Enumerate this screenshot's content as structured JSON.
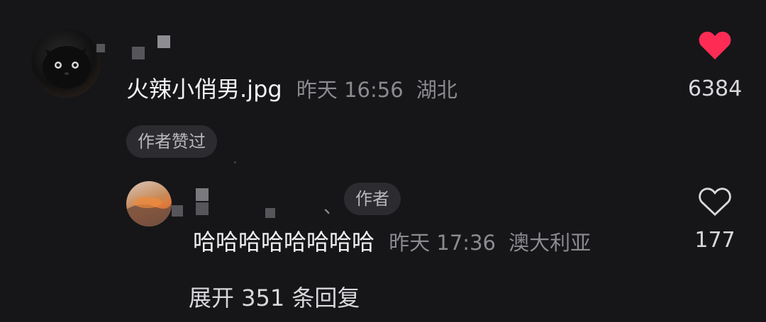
{
  "comment": {
    "text": "火辣小俏男.jpg",
    "time": "昨天 16:56",
    "location": "湖北",
    "badge": "作者赞过",
    "likes": "6384",
    "liked": true
  },
  "reply": {
    "author_tag": "作者",
    "separator": "、",
    "text": "哈哈哈哈哈哈哈哈",
    "time": "昨天 17:36",
    "location": "澳大利亚",
    "likes": "177",
    "liked": false
  },
  "expand_label": "展开 351 条回复",
  "colors": {
    "background": "#161619",
    "like_red": "#fe2c55",
    "meta_gray": "#8a8a8f"
  }
}
